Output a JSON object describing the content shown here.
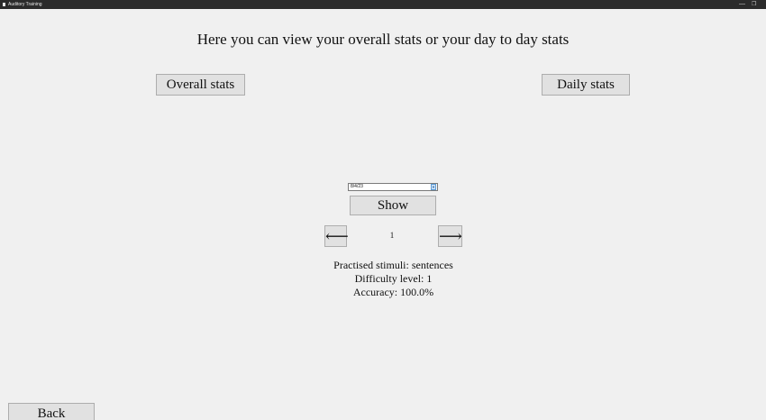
{
  "window": {
    "title": "Auditory Training",
    "minimize_glyph": "—",
    "restore_glyph": "❐"
  },
  "heading": "Here you can view your overall stats or your day to day stats",
  "buttons": {
    "overall": "Overall stats",
    "daily": "Daily stats",
    "show": "Show",
    "prev": "⟵",
    "next": "⟶",
    "back": "Back"
  },
  "date_picker": {
    "value": "8/4/23",
    "arrow_icon": "chevron-down-icon"
  },
  "pagination": {
    "current_page": "1"
  },
  "stats": {
    "stimuli": "Practised stimuli: sentences",
    "difficulty": "Difficulty level: 1",
    "accuracy": "Accuracy: 100.0%"
  }
}
